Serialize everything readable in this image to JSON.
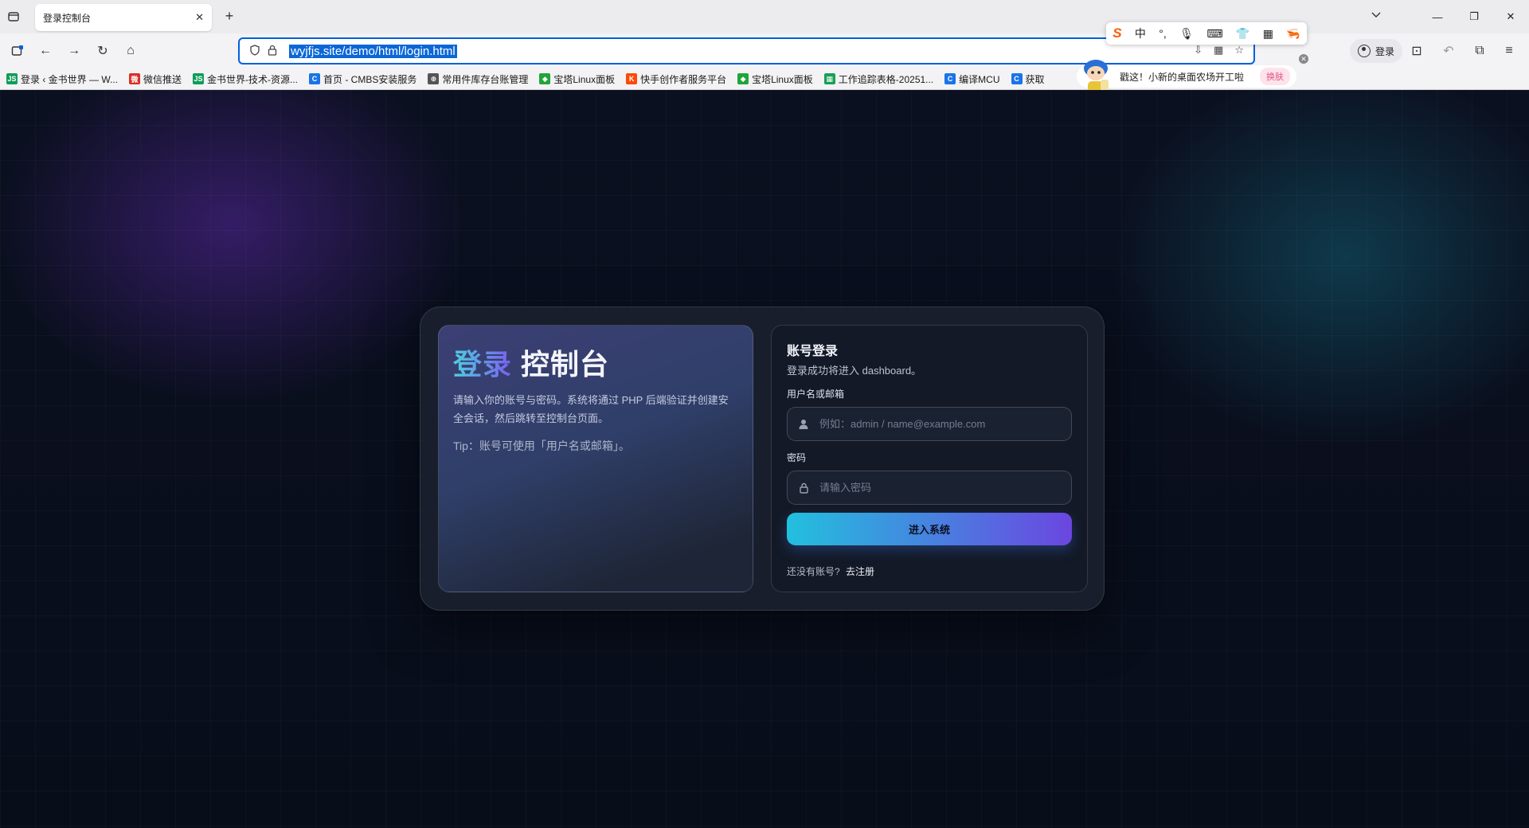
{
  "browser": {
    "tab_title": "登录控制台",
    "tab_close": "✕",
    "new_tab": "+",
    "url": "wyjfjs.site/demo/html/login.html",
    "account_label": "登录",
    "bookmarks": [
      {
        "label": "登录 ‹ 金书世界 — W...",
        "icon": "JS",
        "color": "#0f9d58"
      },
      {
        "label": "微信推送",
        "icon": "微",
        "color": "#d93025"
      },
      {
        "label": "金书世界-技术-资源...",
        "icon": "JS",
        "color": "#0f9d58"
      },
      {
        "label": "首页 - CMBS安装服务",
        "icon": "C",
        "color": "#1a73e8"
      },
      {
        "label": "常用件库存台账管理",
        "icon": "⊕",
        "color": "#555555"
      },
      {
        "label": "宝塔Linux面板",
        "icon": "◆",
        "color": "#20a53a"
      },
      {
        "label": "快手创作者服务平台",
        "icon": "K",
        "color": "#ff4906"
      },
      {
        "label": "宝塔Linux面板",
        "icon": "◆",
        "color": "#20a53a"
      },
      {
        "label": "工作追踪表格-20251...",
        "icon": "▦",
        "color": "#18a058"
      },
      {
        "label": "编译MCU",
        "icon": "C",
        "color": "#1a73e8"
      },
      {
        "label": "获取",
        "icon": "C",
        "color": "#1a73e8"
      }
    ]
  },
  "ime": {
    "lang": "中",
    "banner_text": "戳这！小新的桌面农场开工啦",
    "skin_button": "换肤"
  },
  "login": {
    "headline_accent": "登录",
    "headline_rest": "控制台",
    "description": "请输入你的账号与密码。系统将通过 PHP 后端验证并创建安全会话，然后跳转至控制台页面。",
    "tip": "Tip：账号可使用「用户名或邮箱」。",
    "form_title": "账号登录",
    "form_subtitle": "登录成功将进入 dashboard。",
    "username_label": "用户名或邮箱",
    "username_placeholder": "例如：admin / name@example.com",
    "password_label": "密码",
    "password_placeholder": "请输入密码",
    "submit_label": "进入系统",
    "register_prompt": "还没有账号?",
    "register_link": "去注册"
  },
  "colors": {
    "accent_start": "#22c0de",
    "accent_end": "#6b46e0",
    "page_bg": "#0a0f1c",
    "url_selection": "#0a67d8"
  },
  "icons": [
    "tab-list-icon",
    "back-icon",
    "forward-icon",
    "reload-icon",
    "home-icon",
    "shield-icon",
    "lock-icon",
    "download-icon",
    "qr-icon",
    "star-icon",
    "user-icon",
    "crop-icon",
    "undo-icon",
    "extensions-icon",
    "menu-icon"
  ]
}
